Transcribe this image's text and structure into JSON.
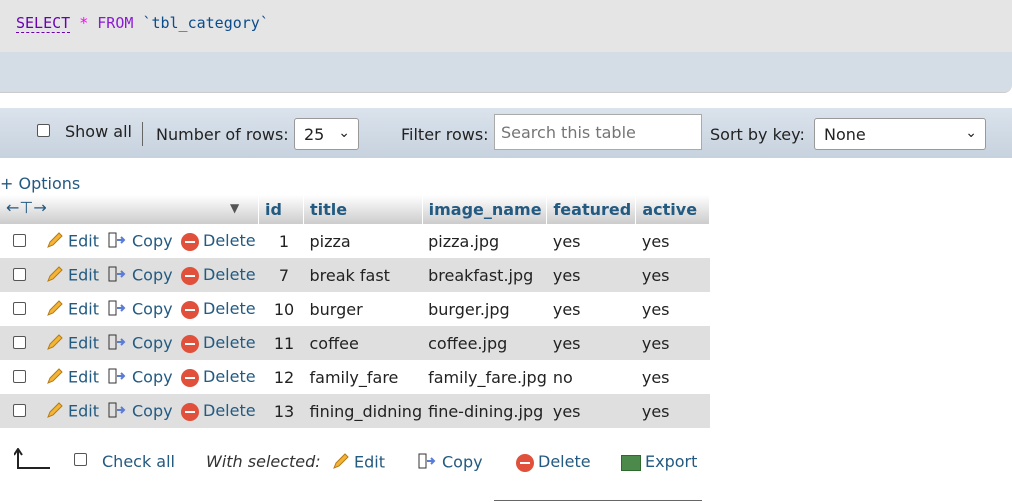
{
  "sql": {
    "select": "SELECT",
    "star": "*",
    "from": "FROM",
    "table": "`tbl_category`"
  },
  "nav": {
    "show_all": "Show all",
    "number_of_rows_label": "Number of rows:",
    "rows_value": "25",
    "filter_label": "Filter rows:",
    "filter_placeholder": "Search this table",
    "sort_label": "Sort by key:",
    "sort_value": "None"
  },
  "options_label": "+ Options",
  "table": {
    "headers": {
      "id": "id",
      "title": "title",
      "image_name": "image_name",
      "featured": "featured",
      "active": "active"
    },
    "actions": {
      "edit": "Edit",
      "copy": "Copy",
      "delete": "Delete"
    },
    "rows": [
      {
        "id": "1",
        "title": "pizza",
        "image_name": "pizza.jpg",
        "featured": "yes",
        "active": "yes"
      },
      {
        "id": "7",
        "title": "break fast",
        "image_name": "breakfast.jpg",
        "featured": "yes",
        "active": "yes"
      },
      {
        "id": "10",
        "title": "burger",
        "image_name": "burger.jpg",
        "featured": "yes",
        "active": "yes"
      },
      {
        "id": "11",
        "title": "coffee",
        "image_name": "coffee.jpg",
        "featured": "yes",
        "active": "yes"
      },
      {
        "id": "12",
        "title": "family_fare",
        "image_name": "family_fare.jpg",
        "featured": "no",
        "active": "yes"
      },
      {
        "id": "13",
        "title": "fining_didning",
        "image_name": "fine-dining.jpg",
        "featured": "yes",
        "active": "yes"
      }
    ]
  },
  "footer": {
    "check_all": "Check all",
    "with_selected": "With selected:",
    "edit": "Edit",
    "copy": "Copy",
    "delete": "Delete",
    "export": "Export"
  }
}
